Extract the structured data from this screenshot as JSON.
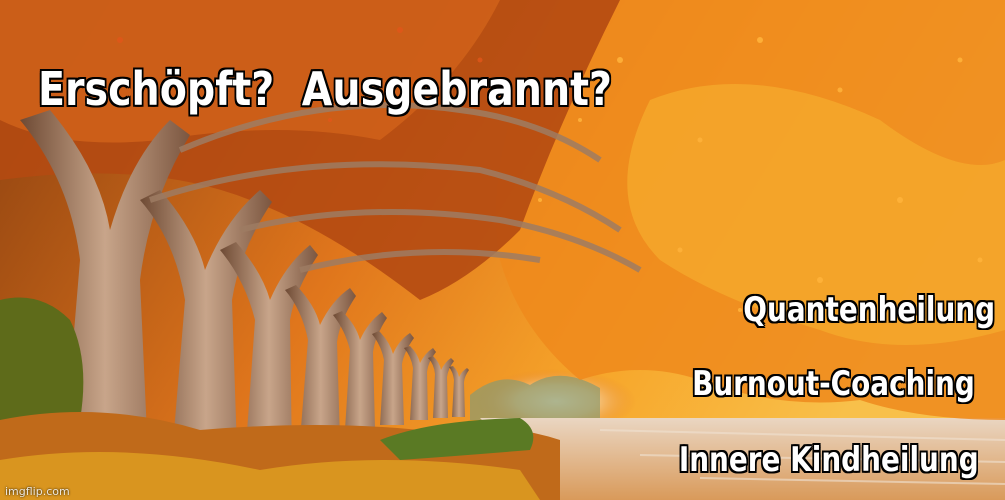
{
  "image": {
    "headline": "Erschöpft?  Ausgebrannt?",
    "services": [
      "Quantenheilung",
      "Burnout-Coaching",
      "Innere Kindheilung"
    ],
    "watermark": "imgflip.com",
    "colors": {
      "foliage_bright": "#f7a11a",
      "foliage_deep": "#c2410c",
      "water": "#e8c8a8",
      "trunk": "#9c7b62",
      "grass": "#4d6b1e",
      "text": "#ffffff",
      "outline": "#000000"
    }
  }
}
